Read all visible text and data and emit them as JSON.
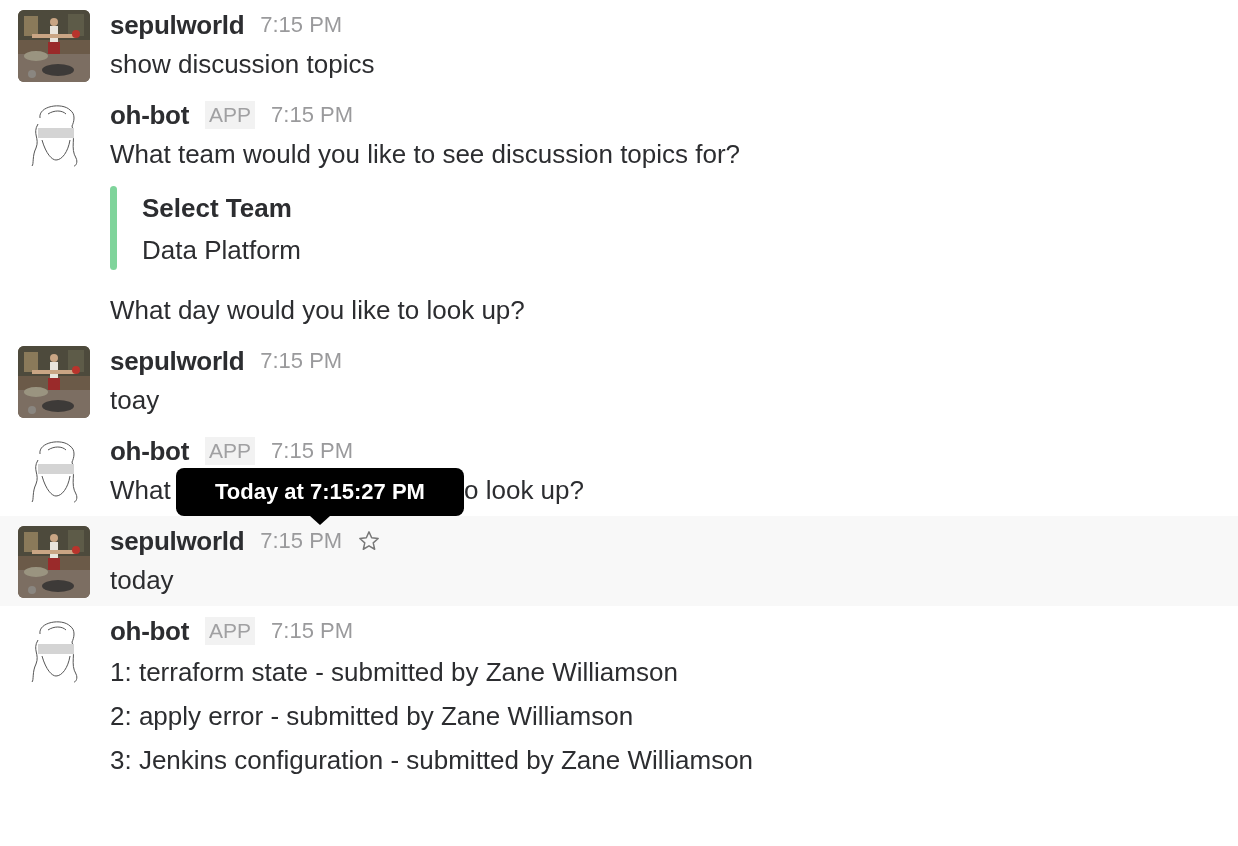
{
  "messages": [
    {
      "kind": "user",
      "author": "sepulworld",
      "time": "7:15 PM",
      "hovered": false,
      "blocks": [
        {
          "kind": "text",
          "text": "show discussion topics"
        }
      ]
    },
    {
      "kind": "bot",
      "author": "oh-bot",
      "badge": "APP",
      "time": "7:15 PM",
      "hovered": false,
      "blocks": [
        {
          "kind": "text",
          "text": "What team would you like to see discussion topics for?"
        },
        {
          "kind": "attachment",
          "title": "Select Team",
          "text": "Data Platform",
          "color": "#7fd49b"
        },
        {
          "kind": "text",
          "text": "What day would you like to look up?"
        }
      ]
    },
    {
      "kind": "user",
      "author": "sepulworld",
      "time": "7:15 PM",
      "hovered": false,
      "blocks": [
        {
          "kind": "text",
          "text": "toay"
        }
      ]
    },
    {
      "kind": "bot",
      "author": "oh-bot",
      "badge": "APP",
      "time": "7:15 PM",
      "hovered": false,
      "blocks": [
        {
          "kind": "covered",
          "parts": [
            "What",
            "o look up?"
          ]
        }
      ]
    },
    {
      "kind": "user",
      "author": "sepulworld",
      "time": "7:15 PM",
      "hovered": true,
      "blocks": [
        {
          "kind": "text",
          "text": "today"
        }
      ]
    },
    {
      "kind": "bot",
      "author": "oh-bot",
      "badge": "APP",
      "time": "7:15 PM",
      "hovered": false,
      "blocks": [
        {
          "kind": "list",
          "items": [
            "1: terraform state - submitted by Zane Williamson",
            "2: apply error - submitted by Zane Williamson",
            "3: Jenkins configuration - submitted by Zane Williamson"
          ]
        }
      ]
    }
  ],
  "tooltip": {
    "text": "Today at 7:15:27 PM"
  }
}
